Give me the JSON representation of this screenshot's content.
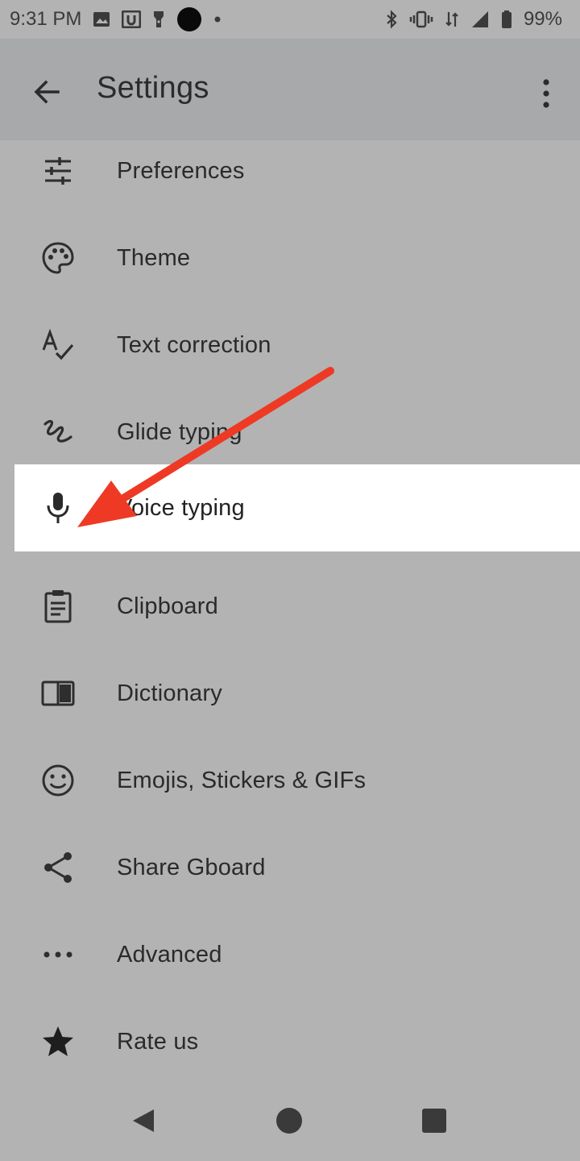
{
  "status_bar": {
    "time": "9:31 PM",
    "battery": "99%"
  },
  "app_bar": {
    "title": "Settings"
  },
  "settings": {
    "items": [
      {
        "label": "Preferences",
        "icon": "sliders-icon"
      },
      {
        "label": "Theme",
        "icon": "palette-icon"
      },
      {
        "label": "Text correction",
        "icon": "text-check-icon"
      },
      {
        "label": "Glide typing",
        "icon": "glide-icon"
      },
      {
        "label": "Voice typing",
        "icon": "microphone-icon",
        "highlighted": true
      },
      {
        "label": "Clipboard",
        "icon": "clipboard-icon"
      },
      {
        "label": "Dictionary",
        "icon": "book-icon"
      },
      {
        "label": "Emojis, Stickers & GIFs",
        "icon": "smiley-icon"
      },
      {
        "label": "Share Gboard",
        "icon": "share-icon"
      },
      {
        "label": "Advanced",
        "icon": "more-horizontal-icon"
      },
      {
        "label": "Rate us",
        "icon": "star-icon"
      }
    ]
  },
  "colors": {
    "background": "#b3b3b3",
    "app_bar": "#a7a9ab",
    "highlight": "#ffffff",
    "arrow": "#ee3a24"
  }
}
